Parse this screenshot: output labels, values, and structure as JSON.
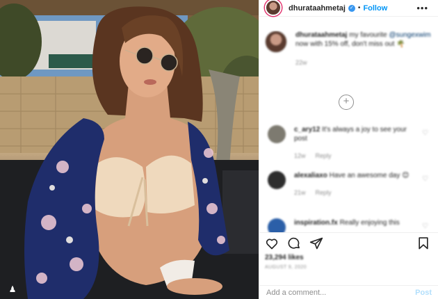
{
  "colors": {
    "accent": "#0095f6",
    "verified": "#3897f0",
    "muted": "#8e8e8e",
    "text": "#262626"
  },
  "post": {
    "username": "dhurataahmetaj",
    "follow_label": "Follow",
    "separator": "•",
    "more_label": "•••",
    "verified_icon": "check",
    "caption": {
      "username": "dhurataahmetaj",
      "text_before": " my favourite ",
      "mention": "@sungexwim",
      "text_after": " now with 15% off, don't miss out 🌴",
      "age": "22w"
    },
    "load_more_label": "+",
    "comments": [
      {
        "username": "c_ary12",
        "text": " It's always a joy to see your post",
        "age": "12w",
        "reply": "Reply"
      },
      {
        "username": "alexaliaxo",
        "text": " Have an awesome day 😊",
        "age": "21w",
        "reply": "Reply"
      },
      {
        "username": "inspiration.fx",
        "text": " Really enjoying this",
        "age": "",
        "reply": ""
      }
    ],
    "likes": "23,294 likes",
    "date": "AUGUST 9, 2020",
    "add_comment_placeholder": "Add a comment...",
    "post_button": "Post"
  }
}
